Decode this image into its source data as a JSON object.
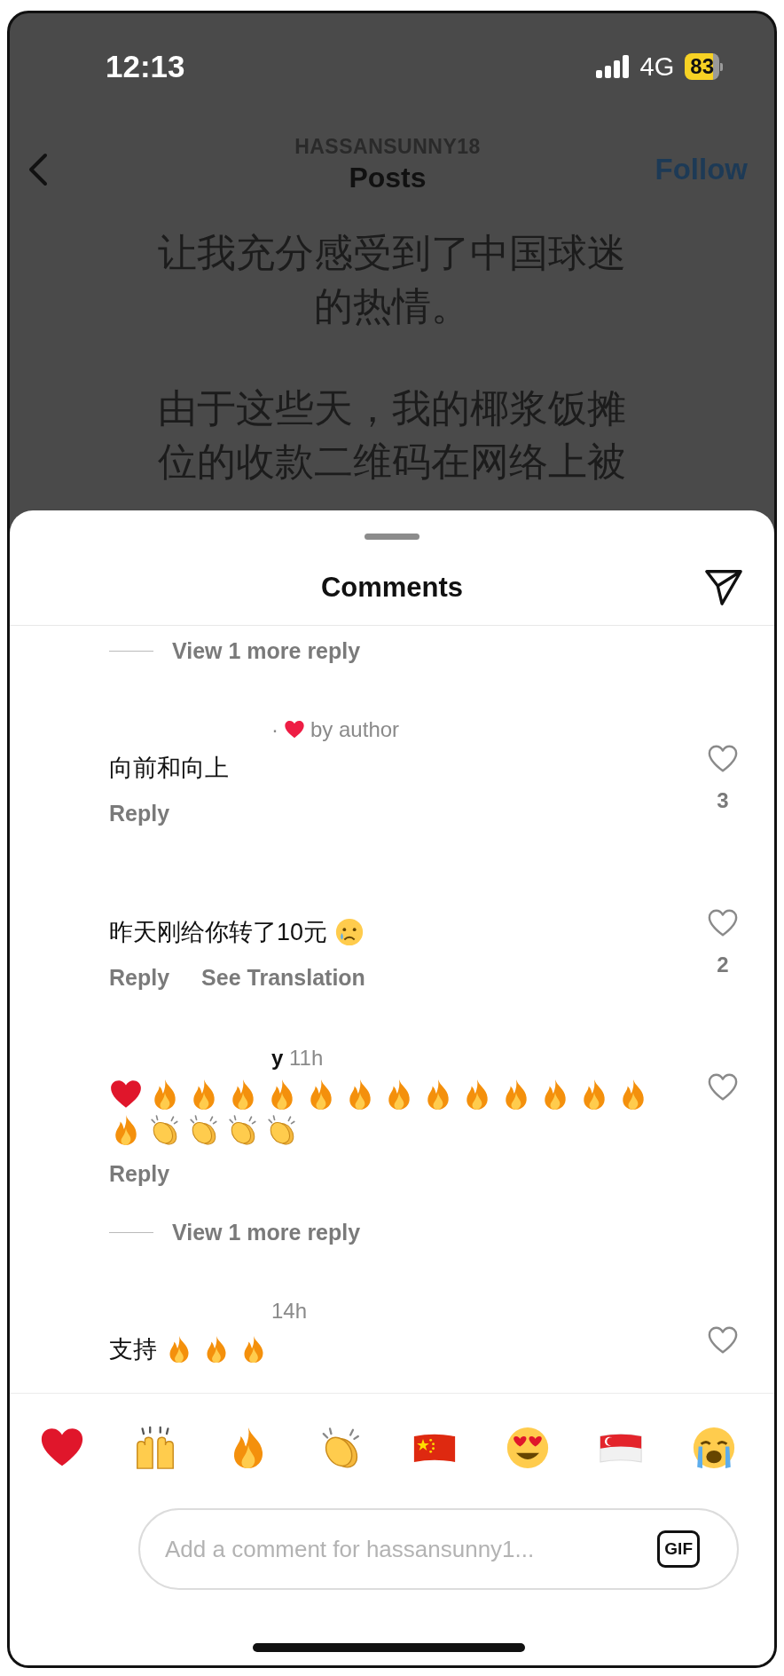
{
  "status_bar": {
    "time": "12:13",
    "network": "4G",
    "battery": "83"
  },
  "header": {
    "username": "HASSANSUNNY18",
    "title": "Posts",
    "follow": "Follow"
  },
  "post": {
    "paragraphs": [
      [
        "让我充分感受到了中国球迷",
        "的热情。"
      ],
      [
        "由于这些天，我的椰浆饭摊",
        "位的收款二维码在网络上被"
      ]
    ]
  },
  "comments_sheet": {
    "title": "Comments",
    "items": [
      {
        "kind": "more_replies",
        "label": "View 1 more reply"
      },
      {
        "kind": "comment",
        "meta": "·",
        "liked_by_author": true,
        "liked_label": "by author",
        "text": "向前和向上",
        "actions": [
          "Reply"
        ],
        "like_count": "3"
      },
      {
        "kind": "comment",
        "liked_by_author": false,
        "text": "昨天刚给你转了10元",
        "emojis": [
          {
            "kind": "sad_tear"
          }
        ],
        "actions": [
          "Reply",
          "See Translation"
        ],
        "like_count": "2"
      },
      {
        "kind": "comment",
        "meta": "**y** 11h",
        "liked_by_author": false,
        "emojis": [
          {
            "kind": "heart"
          },
          {
            "kind": "fire"
          },
          {
            "kind": "fire"
          },
          {
            "kind": "fire"
          },
          {
            "kind": "fire"
          },
          {
            "kind": "fire"
          },
          {
            "kind": "fire"
          },
          {
            "kind": "fire"
          },
          {
            "kind": "fire"
          },
          {
            "kind": "fire"
          },
          {
            "kind": "fire"
          },
          {
            "kind": "fire"
          },
          {
            "kind": "fire"
          },
          {
            "kind": "fire"
          },
          {
            "kind": "fire"
          },
          {
            "kind": "clap"
          },
          {
            "kind": "clap"
          },
          {
            "kind": "clap"
          },
          {
            "kind": "clap"
          }
        ],
        "actions": [
          "Reply"
        ]
      },
      {
        "kind": "more_replies",
        "label": "View 1 more reply"
      },
      {
        "kind": "comment",
        "meta": "14h",
        "liked_by_author": false,
        "text": "支持",
        "emojis": [
          {
            "kind": "fire"
          },
          {
            "kind": "fire"
          },
          {
            "kind": "fire"
          }
        ]
      }
    ]
  },
  "reactions": [
    {
      "kind": "heart"
    },
    {
      "kind": "raised_hands"
    },
    {
      "kind": "fire"
    },
    {
      "kind": "clap"
    },
    {
      "kind": "flag_cn"
    },
    {
      "kind": "heart_eyes"
    },
    {
      "kind": "flag_sg"
    },
    {
      "kind": "crying"
    }
  ],
  "composer": {
    "placeholder": "Add a comment for hassansunny1...",
    "gif": "GIF"
  }
}
